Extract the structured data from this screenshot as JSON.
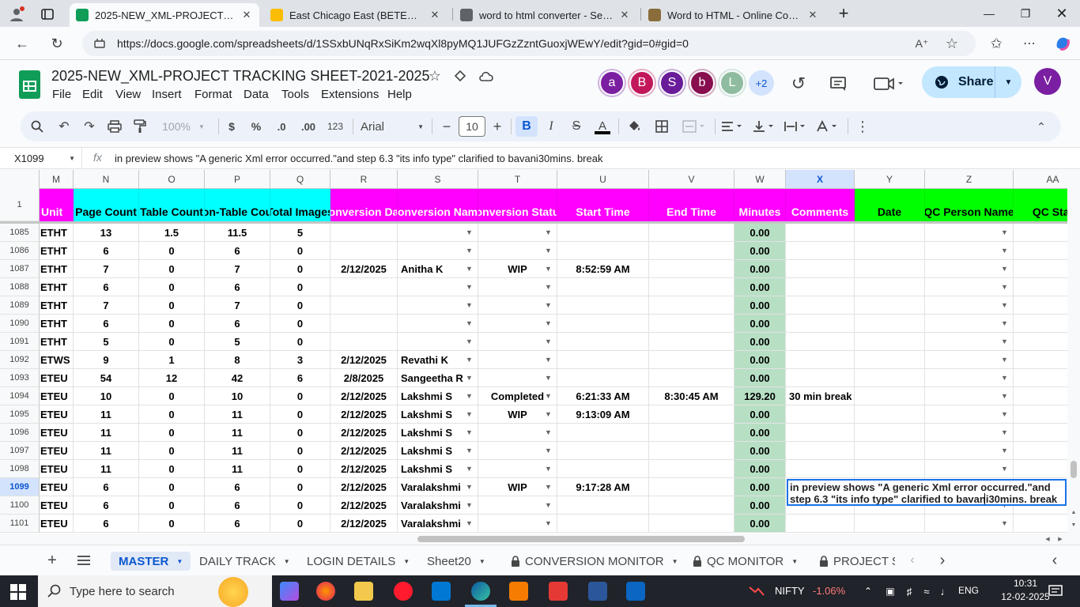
{
  "browser": {
    "tabs": [
      {
        "title": "2025-NEW_XML-PROJECT TRACK",
        "active": true,
        "color": "#0f9d58"
      },
      {
        "title": "East Chicago East (BETEU) - Goog",
        "active": false,
        "color": "#fbbc04"
      },
      {
        "title": "word to html converter - Search",
        "active": false,
        "color": "#5f6368"
      },
      {
        "title": "Word to HTML - Online Converter",
        "active": false,
        "color": "#8a6d3b"
      }
    ],
    "url": "https://docs.google.com/spreadsheets/d/1SSxbUNqRxSiKm2wqXl8pyMQ1JUFGzZzntGuoxjWEwY/edit?gid=0#gid=0"
  },
  "doc": {
    "title": "2025-NEW_XML-PROJECT TRACKING SHEET-2021-2025",
    "menu": [
      "File",
      "Edit",
      "View",
      "Insert",
      "Format",
      "Data",
      "Tools",
      "Extensions",
      "Help"
    ],
    "avatars": [
      {
        "letter": "a",
        "color": "#7b1fa2"
      },
      {
        "letter": "B",
        "color": "#c2185b"
      },
      {
        "letter": "S",
        "color": "#6a1b9a"
      },
      {
        "letter": "b",
        "color": "#880e4f"
      },
      {
        "letter": "L",
        "color": "#8fbca0"
      }
    ],
    "avatar_more": "+2",
    "share_label": "Share",
    "user_avatar": "V"
  },
  "toolbar": {
    "zoom": "100%",
    "currency": "$",
    "percent": "%",
    "dec_less": ".0",
    "dec_more": ".00",
    "format_123": "123",
    "font": "Arial",
    "font_size": "10"
  },
  "formula_bar": {
    "name_box": "X1099",
    "fx": "fx",
    "content": "in preview shows \"A generic Xml error occurred.\"and step 6.3 \"its info type\" clarified to bavani30mins. break"
  },
  "columns": [
    {
      "letter": "M",
      "header": "Unit",
      "color": "#ff00ff",
      "w": 43
    },
    {
      "letter": "N",
      "header": "Page Count",
      "color": "#00ffff",
      "w": 83
    },
    {
      "letter": "O",
      "header": "Table Count",
      "color": "#00ffff",
      "w": 83
    },
    {
      "letter": "P",
      "header": "on-Table Cou",
      "color": "#00ffff",
      "w": 83
    },
    {
      "letter": "Q",
      "header": "Total Images",
      "color": "#00ffff",
      "w": 76
    },
    {
      "letter": "R",
      "header": "onversion Da",
      "color": "#ff00ff",
      "w": 85
    },
    {
      "letter": "S",
      "header": "onversion Nam",
      "color": "#ff00ff",
      "w": 102
    },
    {
      "letter": "T",
      "header": "onversion Statu",
      "color": "#ff00ff",
      "w": 100
    },
    {
      "letter": "U",
      "header": "Start Time",
      "color": "#ff00ff",
      "w": 116
    },
    {
      "letter": "V",
      "header": "End Time",
      "color": "#ff00ff",
      "w": 108
    },
    {
      "letter": "W",
      "header": "Minutes",
      "color": "#ff00ff",
      "w": 65
    },
    {
      "letter": "X",
      "header": "Comments",
      "color": "#ff00ff",
      "w": 87
    },
    {
      "letter": "Y",
      "header": "Date",
      "color": "#00ff00",
      "w": 89
    },
    {
      "letter": "Z",
      "header": "QC Person Name",
      "color": "#00ff00",
      "w": 112
    },
    {
      "letter": "AA",
      "header": "QC Stat",
      "color": "#00ff00",
      "w": 100
    }
  ],
  "header_row_number": "1",
  "rows": [
    {
      "num": "1085",
      "M": "ETHT",
      "N": "13",
      "O": "1.5",
      "P": "11.5",
      "Q": "5",
      "R": "",
      "S": "",
      "T": "",
      "U": "",
      "V": "",
      "W": "0.00",
      "X": ""
    },
    {
      "num": "1086",
      "M": "ETHT",
      "N": "6",
      "O": "0",
      "P": "6",
      "Q": "0",
      "R": "",
      "S": "",
      "T": "",
      "U": "",
      "V": "",
      "W": "0.00",
      "X": ""
    },
    {
      "num": "1087",
      "M": "ETHT",
      "N": "7",
      "O": "0",
      "P": "7",
      "Q": "0",
      "R": "2/12/2025",
      "S": "Anitha K",
      "T": "WIP",
      "U": "8:52:59 AM",
      "V": "",
      "W": "0.00",
      "X": ""
    },
    {
      "num": "1088",
      "M": "ETHT",
      "N": "6",
      "O": "0",
      "P": "6",
      "Q": "0",
      "R": "",
      "S": "",
      "T": "",
      "U": "",
      "V": "",
      "W": "0.00",
      "X": ""
    },
    {
      "num": "1089",
      "M": "ETHT",
      "N": "7",
      "O": "0",
      "P": "7",
      "Q": "0",
      "R": "",
      "S": "",
      "T": "",
      "U": "",
      "V": "",
      "W": "0.00",
      "X": ""
    },
    {
      "num": "1090",
      "M": "ETHT",
      "N": "6",
      "O": "0",
      "P": "6",
      "Q": "0",
      "R": "",
      "S": "",
      "T": "",
      "U": "",
      "V": "",
      "W": "0.00",
      "X": ""
    },
    {
      "num": "1091",
      "M": "ETHT",
      "N": "5",
      "O": "0",
      "P": "5",
      "Q": "0",
      "R": "",
      "S": "",
      "T": "",
      "U": "",
      "V": "",
      "W": "0.00",
      "X": ""
    },
    {
      "num": "1092",
      "M": "ETWS",
      "N": "9",
      "O": "1",
      "P": "8",
      "Q": "3",
      "R": "2/12/2025",
      "S": "Revathi K",
      "T": "",
      "U": "",
      "V": "",
      "W": "0.00",
      "X": ""
    },
    {
      "num": "1093",
      "M": "ETEU",
      "N": "54",
      "O": "12",
      "P": "42",
      "Q": "6",
      "R": "2/8/2025",
      "S": "Sangeetha R",
      "T": "",
      "U": "",
      "V": "",
      "W": "0.00",
      "X": ""
    },
    {
      "num": "1094",
      "M": "ETEU",
      "N": "10",
      "O": "0",
      "P": "10",
      "Q": "0",
      "R": "2/12/2025",
      "S": "Lakshmi S",
      "T": "Completed",
      "U": "6:21:33 AM",
      "V": "8:30:45 AM",
      "W": "129.20",
      "X": "30 min break"
    },
    {
      "num": "1095",
      "M": "ETEU",
      "N": "11",
      "O": "0",
      "P": "11",
      "Q": "0",
      "R": "2/12/2025",
      "S": "Lakshmi S",
      "T": "WIP",
      "U": "9:13:09 AM",
      "V": "",
      "W": "0.00",
      "X": ""
    },
    {
      "num": "1096",
      "M": "ETEU",
      "N": "11",
      "O": "0",
      "P": "11",
      "Q": "0",
      "R": "2/12/2025",
      "S": "Lakshmi S",
      "T": "",
      "U": "",
      "V": "",
      "W": "0.00",
      "X": ""
    },
    {
      "num": "1097",
      "M": "ETEU",
      "N": "11",
      "O": "0",
      "P": "11",
      "Q": "0",
      "R": "2/12/2025",
      "S": "Lakshmi S",
      "T": "",
      "U": "",
      "V": "",
      "W": "0.00",
      "X": ""
    },
    {
      "num": "1098",
      "M": "ETEU",
      "N": "11",
      "O": "0",
      "P": "11",
      "Q": "0",
      "R": "2/12/2025",
      "S": "Lakshmi S",
      "T": "",
      "U": "",
      "V": "",
      "W": "0.00",
      "X": ""
    },
    {
      "num": "1099",
      "M": "ETEU",
      "N": "6",
      "O": "0",
      "P": "6",
      "Q": "0",
      "R": "2/12/2025",
      "S": "Varalakshmi",
      "T": "WIP",
      "U": "9:17:28 AM",
      "V": "",
      "W": "0.00",
      "X": ""
    },
    {
      "num": "1100",
      "M": "ETEU",
      "N": "6",
      "O": "0",
      "P": "6",
      "Q": "0",
      "R": "2/12/2025",
      "S": "Varalakshmi",
      "T": "",
      "U": "",
      "V": "",
      "W": "0.00",
      "X": ""
    },
    {
      "num": "1101",
      "M": "ETEU",
      "N": "6",
      "O": "0",
      "P": "6",
      "Q": "0",
      "R": "2/12/2025",
      "S": "Varalakshmi",
      "T": "",
      "U": "",
      "V": "",
      "W": "0.00",
      "X": ""
    }
  ],
  "selected_row": "1099",
  "editor_text": "in preview shows \"A generic Xml error occurred.\"and step 6.3 \"its info type\" clarified to bavani30mins. break",
  "sheet_tabs": [
    {
      "label": "MASTER",
      "active": true,
      "locked": false
    },
    {
      "label": "DAILY TRACK",
      "active": false,
      "locked": false
    },
    {
      "label": "LOGIN DETAILS",
      "active": false,
      "locked": false
    },
    {
      "label": "Sheet20",
      "active": false,
      "locked": false
    },
    {
      "label": "CONVERSION MONITOR",
      "active": false,
      "locked": true
    },
    {
      "label": "QC MONITOR",
      "active": false,
      "locked": true
    },
    {
      "label": "PROJECT S",
      "active": false,
      "locked": true
    }
  ],
  "taskbar": {
    "search_placeholder": "Type here to search",
    "stock": "NIFTY",
    "stock_change": "-1.06%",
    "lang": "ENG",
    "time": "10:31",
    "date": "12-02-2025"
  }
}
